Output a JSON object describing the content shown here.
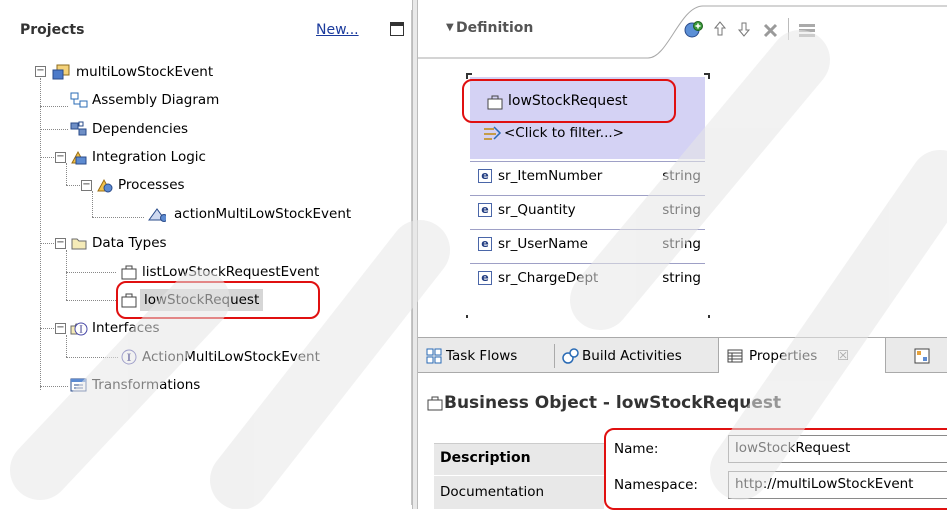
{
  "projects": {
    "title": "Projects",
    "new_link": "New...",
    "tree": {
      "root": "multiLowStockEvent",
      "assembly": "Assembly Diagram",
      "dependencies": "Dependencies",
      "integration": "Integration Logic",
      "processes": "Processes",
      "process_item": "actionMultiLowStockEvent",
      "data_types": "Data Types",
      "dt_item1": "listLowStockRequestEvent",
      "dt_item2": "lowStockRequest",
      "interfaces": "Interfaces",
      "if_item": "ActionMultiLowStockEvent",
      "transformations": "Transformations"
    }
  },
  "definition": {
    "title": "Definition",
    "bo_name": "lowStockRequest",
    "filter": "<Click to filter...>",
    "fields": [
      {
        "name": "sr_ItemNumber",
        "type": "string"
      },
      {
        "name": "sr_Quantity",
        "type": "string"
      },
      {
        "name": "sr_UserName",
        "type": "string"
      },
      {
        "name": "sr_ChargeDept",
        "type": "string"
      }
    ],
    "element_badge": "e"
  },
  "bottom_tabs": {
    "task_flows": "Task Flows",
    "build_activities": "Build Activities",
    "properties": "Properties",
    "close_glyph": "☒"
  },
  "properties": {
    "heading": "Business Object - lowStockRequest",
    "description": "Description",
    "documentation": "Documentation",
    "name_label": "Name:",
    "name_value": "lowStockRequest",
    "namespace_label": "Namespace:",
    "namespace_value": "http://multiLowStockEvent"
  },
  "colors": {
    "highlight": "#e01010",
    "bo_header": "#d4d2f4",
    "link": "#1a3a9c"
  }
}
